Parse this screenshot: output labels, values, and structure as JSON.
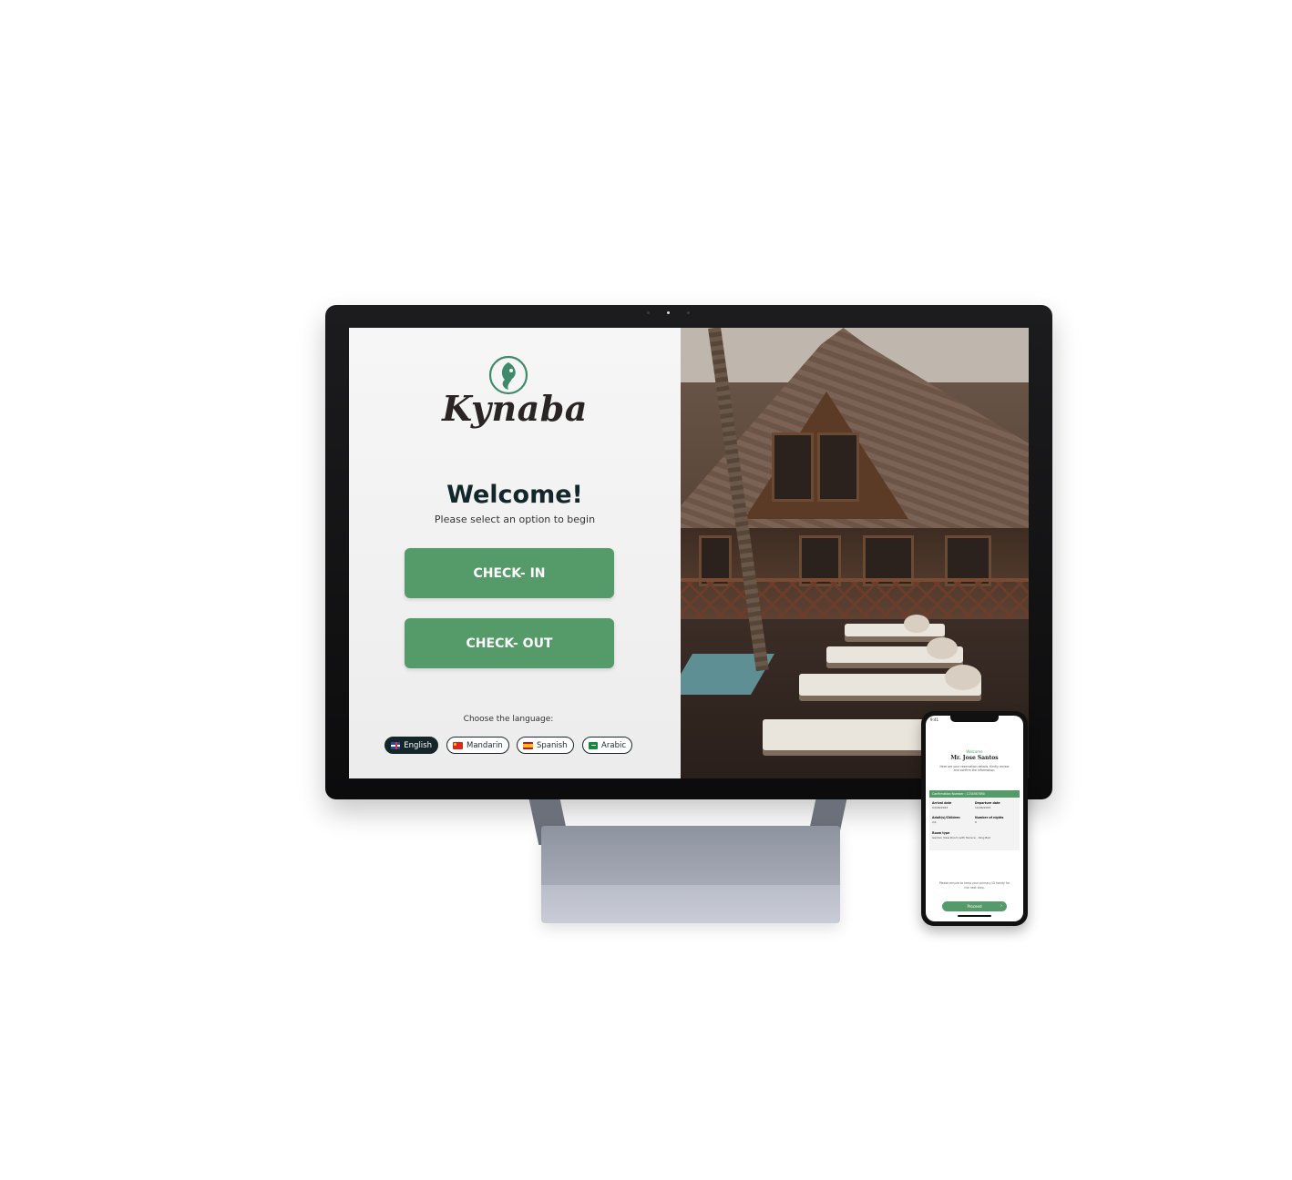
{
  "kiosk": {
    "brand": "Kynaba",
    "welcome_title": "Welcome!",
    "subtitle": "Please select an option to begin",
    "check_in_label": "CHECK- IN",
    "check_out_label": "CHECK- OUT",
    "language_prompt": "Choose the language:",
    "languages": [
      {
        "label": "English",
        "flag": "uk-flag-icon",
        "selected": true
      },
      {
        "label": "Mandarin",
        "flag": "china-flag-icon",
        "selected": false
      },
      {
        "label": "Spanish",
        "flag": "spain-flag-icon",
        "selected": false
      },
      {
        "label": "Arabic",
        "flag": "saudi-flag-icon",
        "selected": false
      }
    ]
  },
  "mobile": {
    "status_time": "9:41",
    "welcome": "Welcome",
    "guest_name": "Mr. Jose Santos",
    "intro": "Here are your reservation details. Kindly review and confirm the information.",
    "confirmation_label": "Confirmation Number : 1234567890",
    "fields": {
      "arrival_label": "Arrival date",
      "arrival_value": "04/06/2023",
      "departure_label": "Departure date",
      "departure_value": "10/06/2023",
      "adults_label": "Adult(s)/Children",
      "adults_value": "2/1",
      "nights_label": "Number of nights",
      "nights_value": "6",
      "room_label": "Room type",
      "room_value": "Garden View Room with Terrace - King Bed"
    },
    "footer_note": "Please ensure to keep your primary ID handy for the next step.",
    "proceed_label": "Proceed"
  },
  "colors": {
    "accent_green": "#559a69",
    "dark_text": "#13262b",
    "monitor_bezel": "#111111"
  }
}
